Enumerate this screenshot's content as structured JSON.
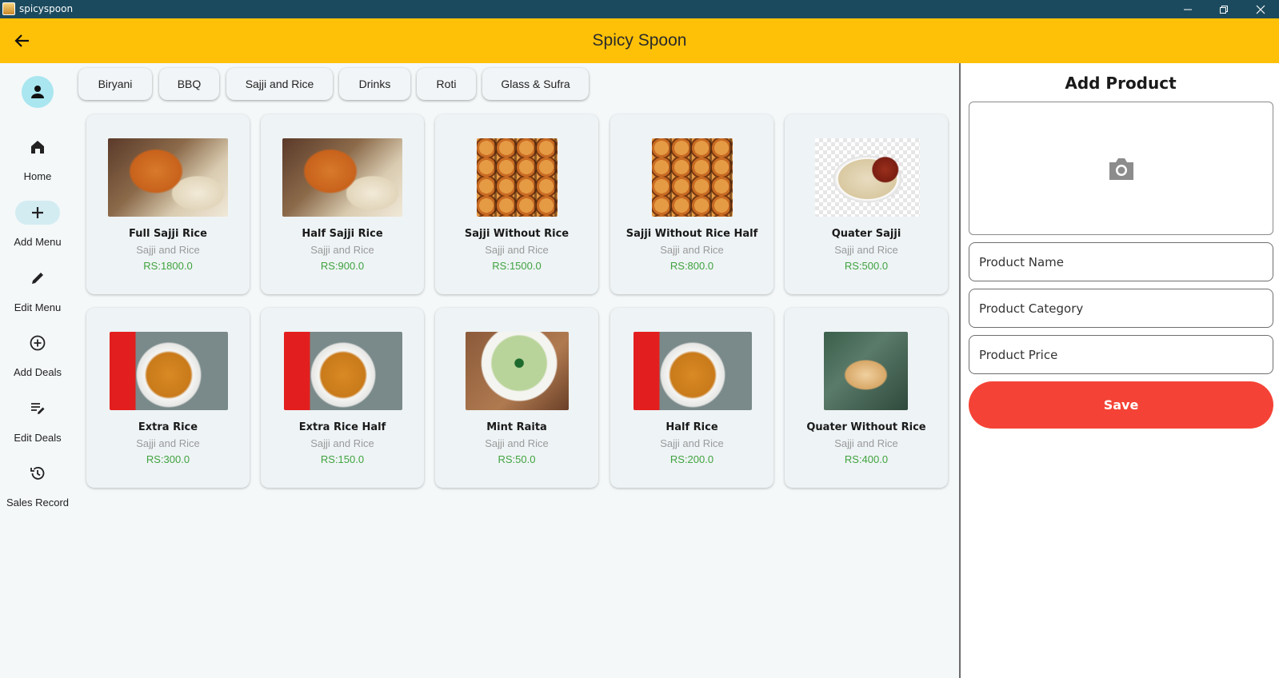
{
  "window": {
    "title": "spicyspoon"
  },
  "appbar": {
    "title": "Spicy Spoon"
  },
  "sidebar": {
    "items": [
      {
        "label": "Home",
        "icon": "home-icon"
      },
      {
        "label": "Add Menu",
        "icon": "plus-icon",
        "active": true
      },
      {
        "label": "Edit Menu",
        "icon": "pencil-icon"
      },
      {
        "label": "Add Deals",
        "icon": "add-circle-icon"
      },
      {
        "label": "Edit Deals",
        "icon": "edit-list-icon"
      },
      {
        "label": "Sales Record",
        "icon": "history-icon"
      }
    ]
  },
  "categories": [
    "Biryani",
    "BBQ",
    "Sajji and Rice",
    "Drinks",
    "Roti",
    "Glass & Sufra"
  ],
  "products": [
    {
      "name": "Full Sajji Rice",
      "category": "Sajji and Rice",
      "price": "RS:1800.0"
    },
    {
      "name": "Half Sajji Rice",
      "category": "Sajji and Rice",
      "price": "RS:900.0"
    },
    {
      "name": "Sajji Without Rice",
      "category": "Sajji and Rice",
      "price": "RS:1500.0"
    },
    {
      "name": "Sajji Without Rice Half",
      "category": "Sajji and Rice",
      "price": "RS:800.0"
    },
    {
      "name": "Quater Sajji",
      "category": "Sajji and Rice",
      "price": "RS:500.0"
    },
    {
      "name": "Extra Rice",
      "category": "Sajji and Rice",
      "price": "RS:300.0"
    },
    {
      "name": "Extra Rice Half",
      "category": "Sajji and Rice",
      "price": "RS:150.0"
    },
    {
      "name": "Mint Raita",
      "category": "Sajji and Rice",
      "price": "RS:50.0"
    },
    {
      "name": "Half Rice",
      "category": "Sajji and Rice",
      "price": "RS:200.0"
    },
    {
      "name": "Quater Without Rice",
      "category": "Sajji and Rice",
      "price": "RS:400.0"
    }
  ],
  "add_product": {
    "title": "Add Product",
    "name_placeholder": "Product Name",
    "category_placeholder": "Product Category",
    "price_placeholder": "Product Price",
    "save_label": "Save"
  },
  "colors": {
    "titlebar": "#1b4a5e",
    "appbar": "#ffc107",
    "save": "#f44336",
    "price": "#3fa33f",
    "avatar": "#a9e6f0"
  }
}
